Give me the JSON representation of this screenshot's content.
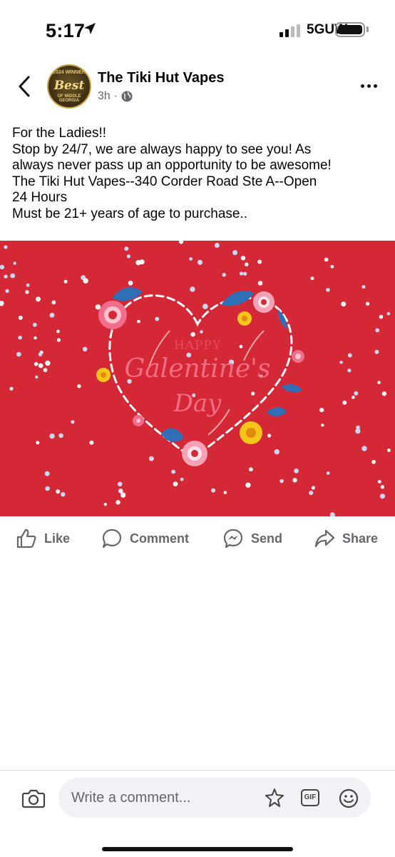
{
  "status_bar": {
    "time": "5:17",
    "network": "5GUW",
    "battery_level": 1.0
  },
  "post": {
    "page_name": "The Tiki Hut Vapes",
    "time_ago": "3h",
    "separator": "·",
    "avatar": {
      "top_text": "2024 WINNER",
      "main_text": "Best",
      "bottom_text": "OF MIDDLE GEORGIA"
    },
    "text_lines": [
      "For the Ladies!!",
      "Stop by 24/7, we are always happy to see you! As",
      "always never pass up an opportunity to be awesome!",
      "The Tiki Hut Vapes--340 Corder Road Ste A--Open",
      "24 Hours",
      "Must be 21+ years of age to purchase.."
    ],
    "image": {
      "happy": "HAPPY",
      "title": "Galentine's",
      "day": "Day",
      "background_color": "#d52836"
    }
  },
  "actions": {
    "like": "Like",
    "comment": "Comment",
    "send": "Send",
    "share": "Share"
  },
  "comment_bar": {
    "placeholder": "Write a comment...",
    "gif_label": "GIF"
  },
  "icons": [
    "location-arrow-icon",
    "signal-icon",
    "battery-icon",
    "back-chevron-icon",
    "globe-icon",
    "more-icon",
    "like-icon",
    "comment-icon",
    "messenger-icon",
    "share-icon",
    "camera-icon",
    "sticker-icon",
    "gif-icon",
    "emoji-icon"
  ]
}
